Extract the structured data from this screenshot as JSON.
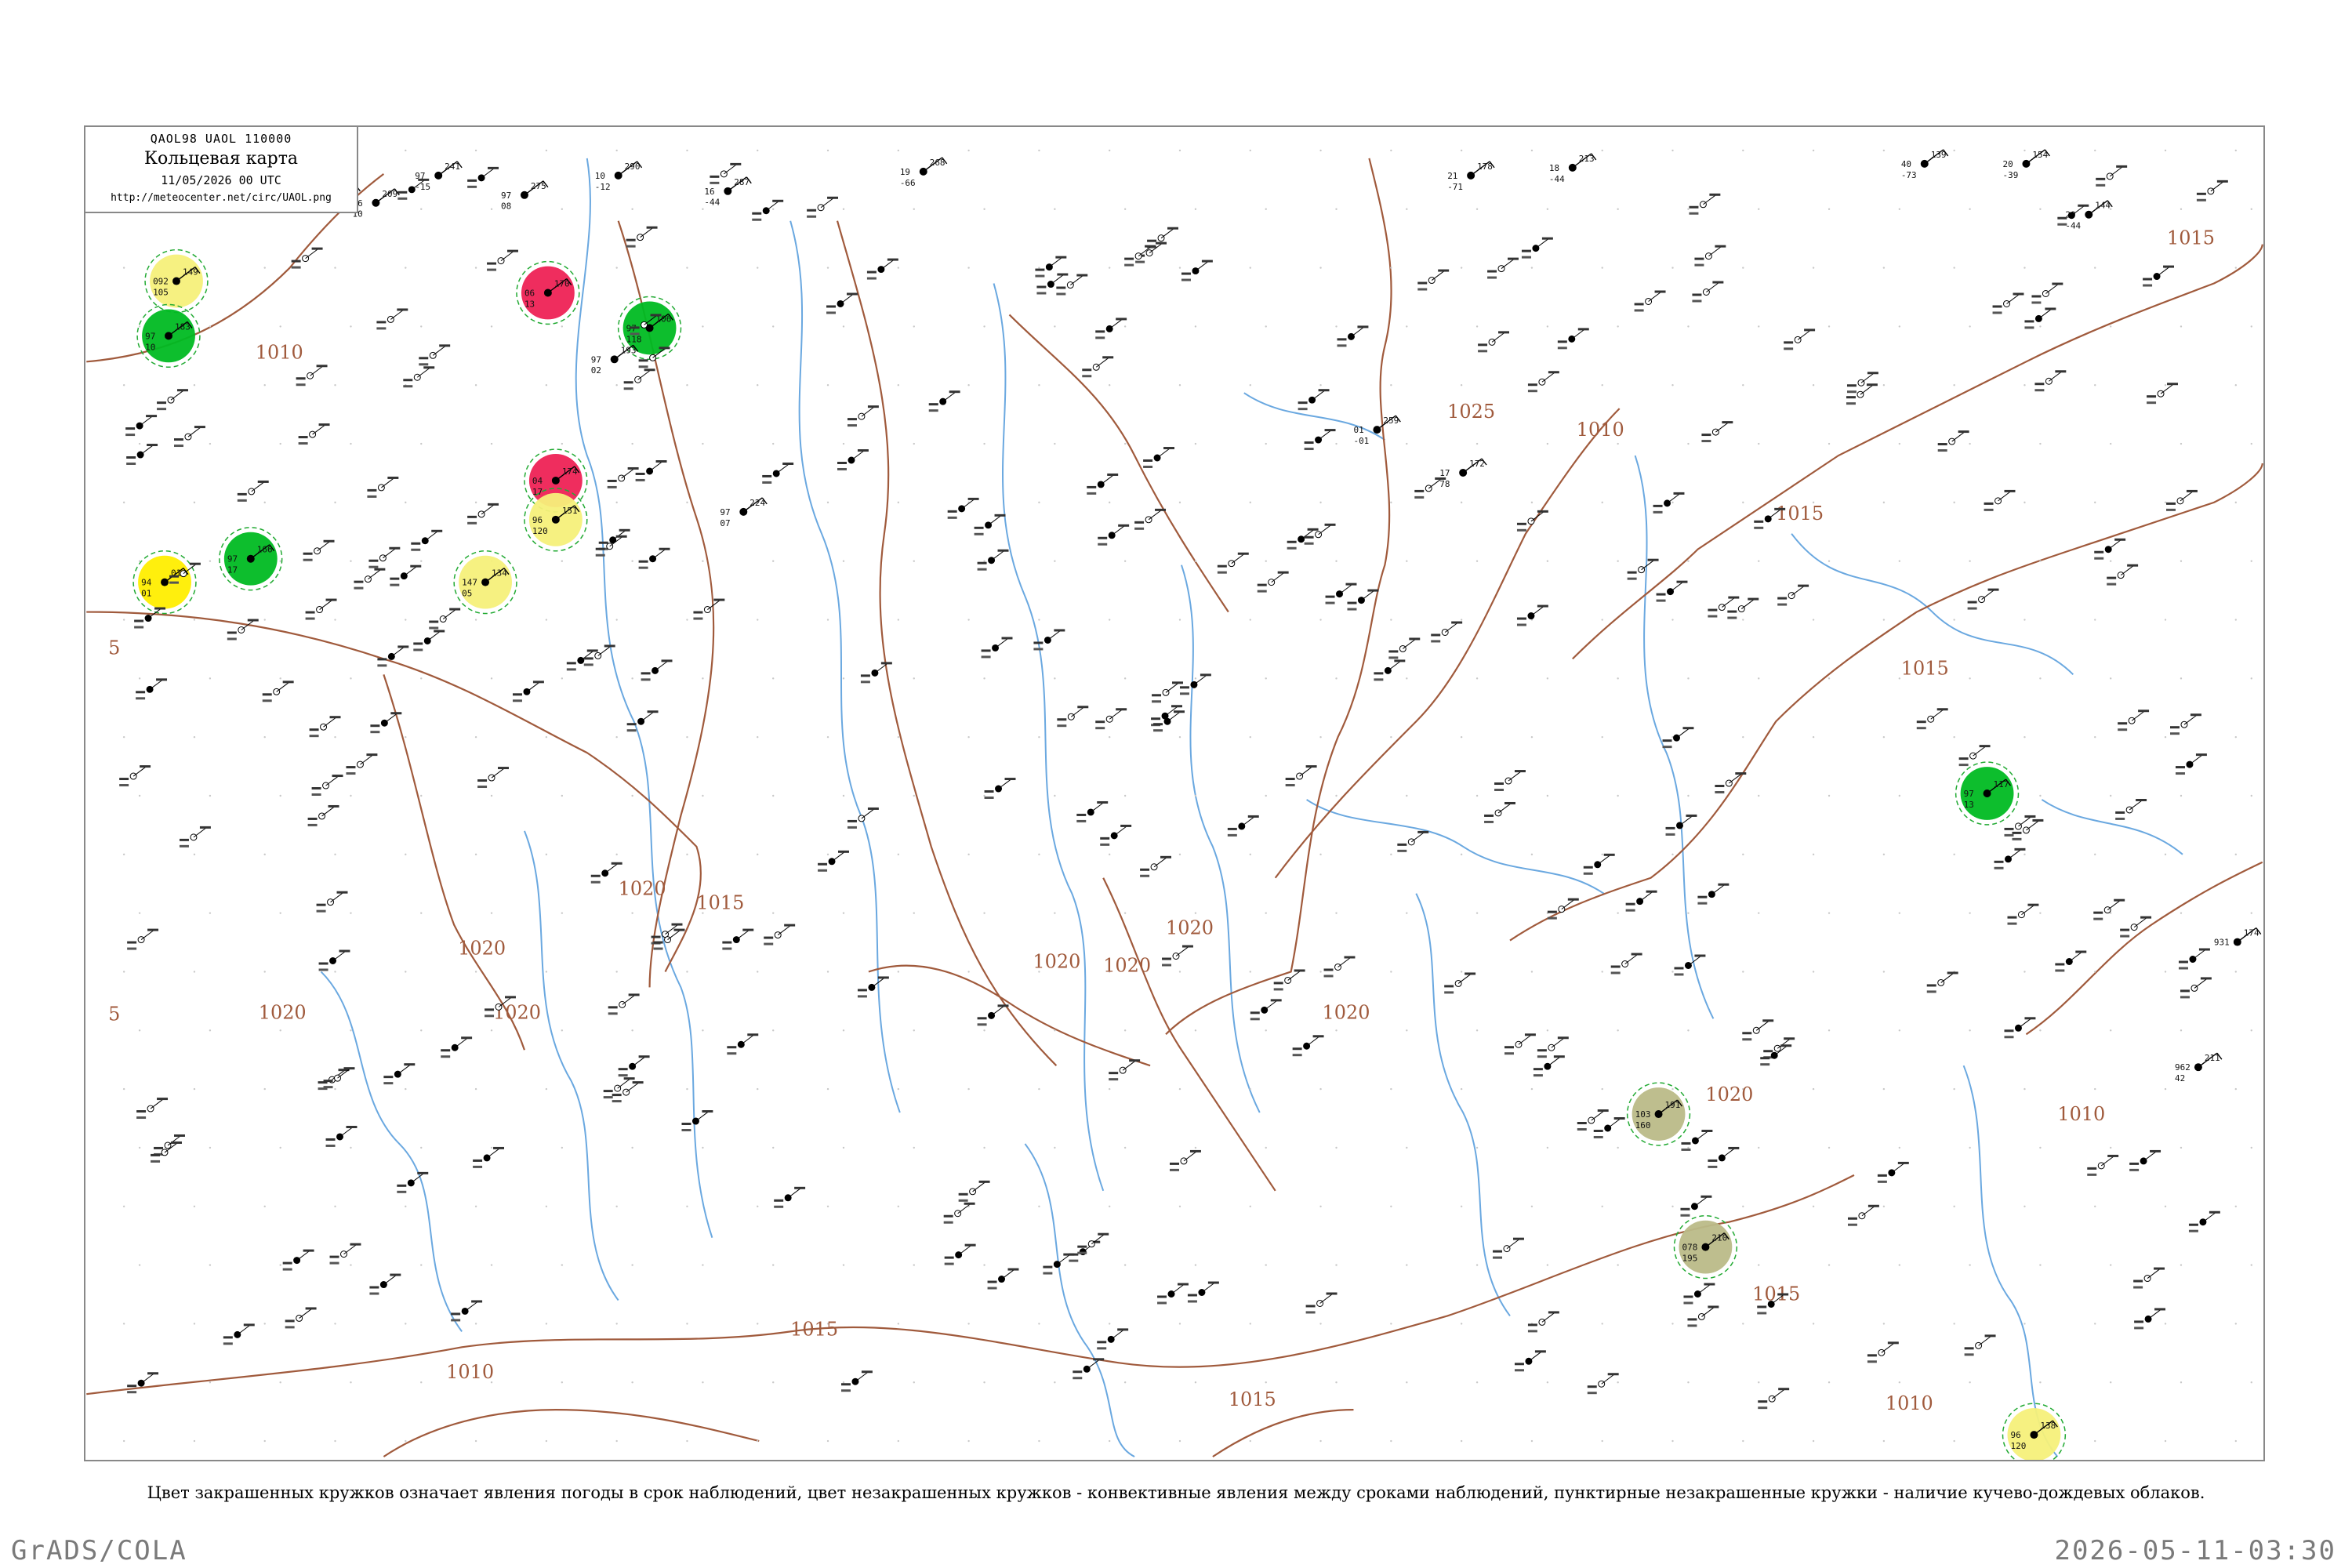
{
  "header": {
    "code": "QAOL98  UAOL  110000",
    "title": "Кольцевая карта",
    "date": "11/05/2026 00 UTC",
    "url": "http://meteocenter.net/circ/UAOL.png"
  },
  "caption": "Цвет закрашенных кружков означает явления погоды в срок наблюдений, цвет незакрашенных кружков - конвективные явления между сроками наблюдений, пунктирные незакрашенные кружки - наличие кучево-дождевых облаков.",
  "footer": {
    "left": "GrADS/COLA",
    "right": "2026-05-11-03:30"
  },
  "colors": {
    "isobar": "#a05a3c",
    "river": "#6aa8e0",
    "rain": "#00bb22",
    "thunder": "#ee2255",
    "fog": "#f5f07a",
    "fog_bright": "#ffee00",
    "dust": "#bbbb88",
    "cb_dashed": "#22aa33",
    "conv_ring": "#dd4477"
  },
  "isobar_labels": [
    "1010",
    "1015",
    "1020",
    "1025",
    "5"
  ],
  "stations": [
    {
      "p": "189",
      "t": "10",
      "d": "-1",
      "kind": "none"
    },
    {
      "p": "209",
      "t": "16",
      "d": "10",
      "kind": "none"
    },
    {
      "p": "241",
      "t": "97",
      "d": "-15",
      "kind": "none"
    },
    {
      "p": "275",
      "t": "97",
      "d": "08",
      "kind": "none"
    },
    {
      "p": "290",
      "t": "10",
      "d": "-12",
      "kind": "none"
    },
    {
      "p": "287",
      "t": "16",
      "d": "-44",
      "kind": "none"
    },
    {
      "p": "268",
      "t": "19",
      "d": "-66",
      "kind": "none"
    },
    {
      "p": "178",
      "t": "21",
      "d": "-71",
      "kind": "none"
    },
    {
      "p": "139",
      "t": "40",
      "d": "-73",
      "kind": "none"
    },
    {
      "p": "154",
      "t": "20",
      "d": "-39",
      "kind": "none"
    },
    {
      "p": "144",
      "t": "20",
      "d": "-44",
      "kind": "none"
    },
    {
      "p": "213",
      "t": "18",
      "d": "-44",
      "kind": "none"
    },
    {
      "p": "149",
      "t": "092",
      "d": "105",
      "kind": "fog"
    },
    {
      "p": "183",
      "t": "97",
      "d": "10",
      "kind": "rain"
    },
    {
      "p": "160",
      "t": "97",
      "d": "12",
      "kind": "rain"
    },
    {
      "p": "170",
      "t": "06",
      "d": "13",
      "kind": "thunder"
    },
    {
      "p": "174",
      "t": "04",
      "d": "17",
      "kind": "thunder"
    },
    {
      "p": "151",
      "t": "96",
      "d": "120",
      "kind": "fog"
    },
    {
      "p": "134",
      "t": "147",
      "d": "05",
      "kind": "fog"
    },
    {
      "p": "01",
      "t": "94",
      "d": "01",
      "kind": "fog_bright"
    },
    {
      "p": "191",
      "t": "103",
      "d": "160",
      "kind": "dust"
    },
    {
      "p": "210",
      "t": "078",
      "d": "195",
      "kind": "dust"
    },
    {
      "p": "138",
      "t": "96",
      "d": "120",
      "kind": "fog"
    },
    {
      "p": "117",
      "t": "97",
      "d": "13",
      "kind": "rain"
    },
    {
      "p": "166",
      "t": "97",
      "d": "17",
      "kind": "rain"
    },
    {
      "p": "106",
      "t": "97",
      "d": "118",
      "kind": "rain"
    },
    {
      "p": "193",
      "t": "97",
      "d": "02",
      "kind": "none"
    },
    {
      "p": "224",
      "t": "97",
      "d": "07",
      "kind": "none"
    },
    {
      "p": "259",
      "t": "01",
      "d": "-01",
      "kind": "none"
    },
    {
      "p": "172",
      "t": "17",
      "d": "78",
      "kind": "none"
    },
    {
      "p": "174",
      "t": "931",
      "d": "",
      "kind": "none"
    },
    {
      "p": "211",
      "t": "962",
      "d": "42",
      "kind": "none"
    }
  ]
}
